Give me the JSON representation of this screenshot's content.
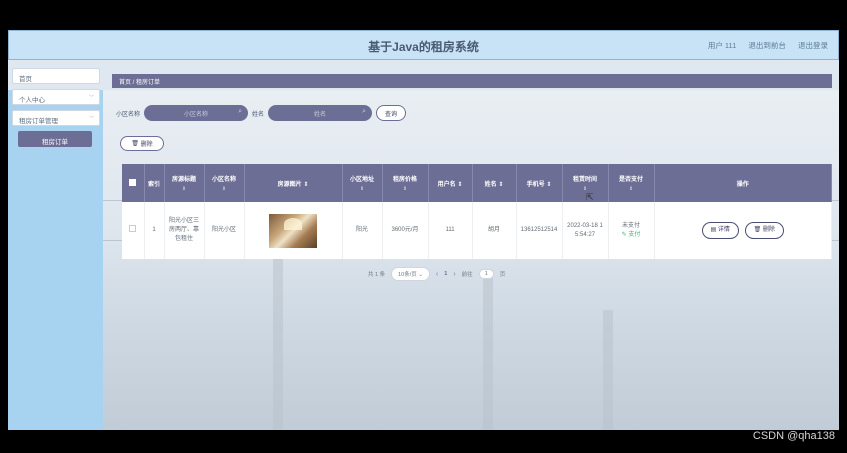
{
  "header": {
    "title": "基于Java的租房系统",
    "user": "用户 111",
    "back_to_front": "退出到前台",
    "logout": "退出登录"
  },
  "sidebar": {
    "items": [
      {
        "label": "首页"
      },
      {
        "label": "个人中心"
      },
      {
        "label": "租房订单管理"
      },
      {
        "label": "租房订单"
      }
    ]
  },
  "breadcrumb": "首页 / 租房订单",
  "search": {
    "community_label": "小区名称",
    "community_placeholder": "小区名称",
    "name_label": "姓名",
    "name_placeholder": "姓名",
    "query_button": "查询",
    "delete_button": "删除"
  },
  "table": {
    "headers": [
      "索引",
      "房源标题",
      "小区名称",
      "房源图片",
      "小区地址",
      "租房价格",
      "用户名",
      "姓名",
      "手机号",
      "租赁时间",
      "是否支付",
      "操作"
    ],
    "rows": [
      {
        "index": "1",
        "title": "阳光小区三房两厅、靠包租住",
        "community": "阳光小区",
        "address": "阳光",
        "price": "3600元/月",
        "username": "111",
        "name": "胡月",
        "phone": "13612512514",
        "rent_time": "2022-03-18 15:54:27",
        "paid": "未支付",
        "pay_link": "支付",
        "detail_button": "详情",
        "delete_button": "删除"
      }
    ]
  },
  "pagination": {
    "total": "共 1 条",
    "page_size": "10条/页",
    "current_page": "1",
    "goto_label": "前往",
    "goto_value": "1",
    "page_suffix": "页"
  },
  "watermark": "CSDN @qha138"
}
